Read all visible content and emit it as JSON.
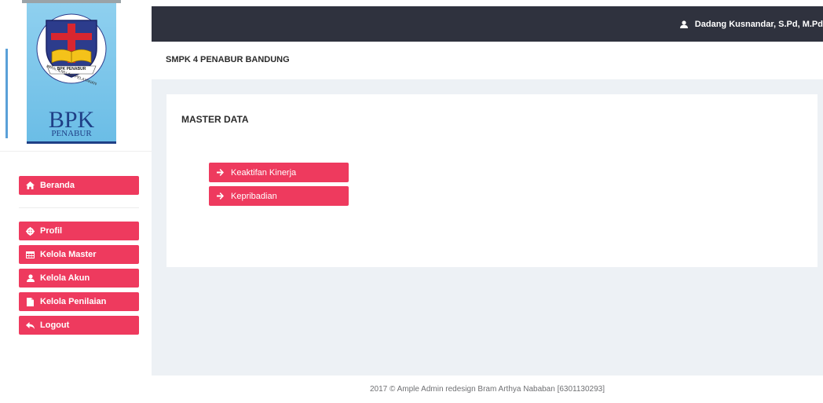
{
  "logo": {
    "motto": "IMAN, ILMU dan PELAYANAN",
    "banner": "BPK PENABUR",
    "wordmark": "BPK",
    "subword": "PENABUR"
  },
  "sidebar": {
    "items": [
      {
        "label": "Beranda",
        "icon": "home-icon"
      },
      {
        "label": "Profil",
        "icon": "gear-icon"
      },
      {
        "label": "Kelola Master",
        "icon": "table-icon"
      },
      {
        "label": "Kelola Akun",
        "icon": "user-icon"
      },
      {
        "label": "Kelola Penilaian",
        "icon": "file-icon"
      },
      {
        "label": "Logout",
        "icon": "reply-icon"
      }
    ]
  },
  "topbar": {
    "user_name": "Dadang Kusnandar, S.Pd, M.Pd"
  },
  "breadcrumb": {
    "title": "SMPK 4 PENABUR BANDUNG"
  },
  "panel": {
    "title": "MASTER DATA",
    "buttons": [
      {
        "label": "Keaktifan Kinerja",
        "icon": "arrow-right-icon"
      },
      {
        "label": "Kepribadian",
        "icon": "arrow-right-icon"
      }
    ]
  },
  "footer": {
    "text": "2017 © Ample Admin redesign Bram Arthya Nababan [6301130293]"
  },
  "colors": {
    "accent": "#ee3a5e",
    "topbar": "#2f323e",
    "content_bg": "#edf1f5",
    "logo_blue": "#7ec6ea"
  }
}
